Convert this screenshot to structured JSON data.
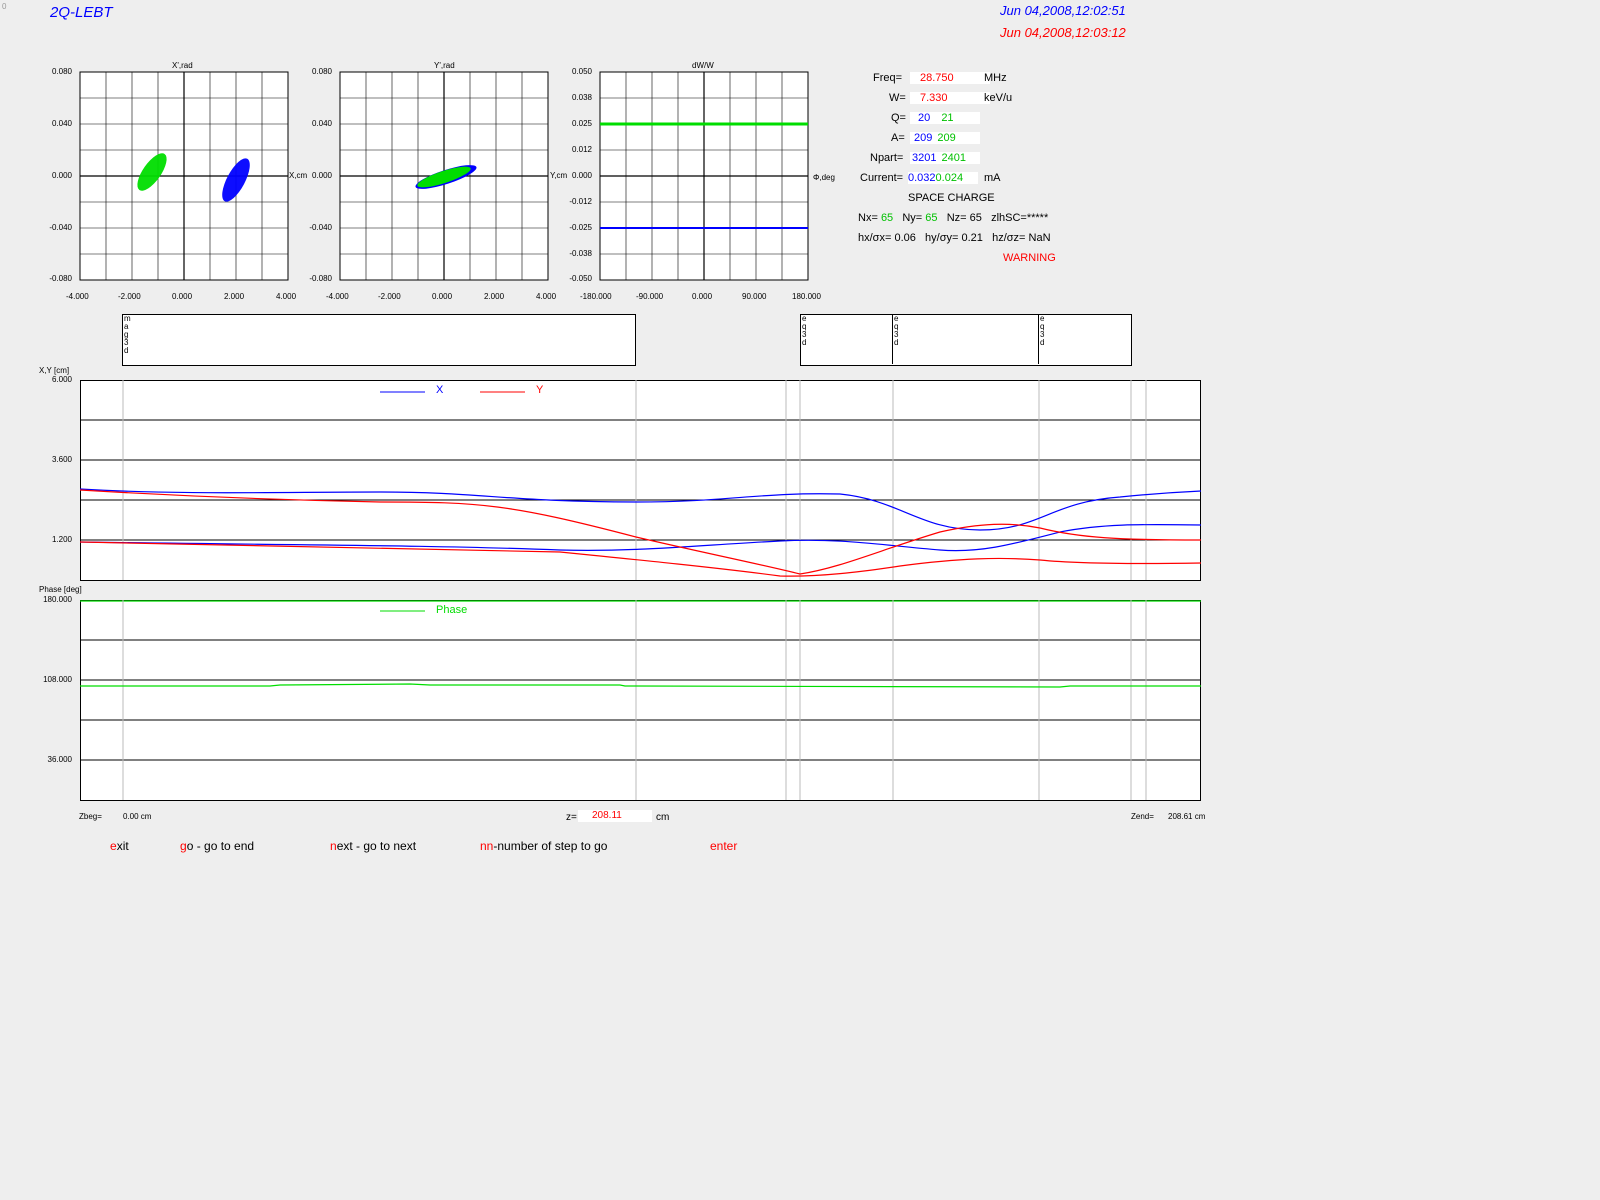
{
  "window": {
    "corner_mark": "0",
    "title": "2Q-LEBT",
    "date_start": "Jun 04,2008,12:02:51",
    "date_end": "Jun 04,2008,12:03:12"
  },
  "phase_plots": {
    "x_plot": {
      "title": "X',rad",
      "side_label": "X,cm",
      "y_ticks": [
        "0.080",
        "0.040",
        "0.000",
        "-0.040",
        "-0.080"
      ],
      "x_ticks": [
        "-4.000",
        "-2.000",
        "0.000",
        "2.000",
        "4.000"
      ]
    },
    "y_plot": {
      "title": "Y',rad",
      "side_label": "Y,cm",
      "y_ticks": [
        "0.080",
        "0.040",
        "0.000",
        "-0.040",
        "-0.080"
      ],
      "x_ticks": [
        "-4.000",
        "-2.000",
        "0.000",
        "2.000",
        "4.000"
      ]
    },
    "w_plot": {
      "title": "dW/W",
      "side_label": "Φ,deg",
      "y_ticks": [
        "0.050",
        "0.038",
        "0.025",
        "0.012",
        "0.000",
        "-0.012",
        "-0.025",
        "-0.038",
        "-0.050"
      ],
      "x_ticks": [
        "-180.000",
        "-90.000",
        "0.000",
        "90.000",
        "180.000"
      ]
    }
  },
  "params": {
    "freq": {
      "label": "Freq=",
      "value": "28.750",
      "unit": "MHz"
    },
    "w": {
      "label": "W=",
      "value": "7.330",
      "unit": "keV/u"
    },
    "q": {
      "label": "Q=",
      "v1": "20",
      "v2": "21"
    },
    "a": {
      "label": "A=",
      "v1": "209",
      "v2": "209"
    },
    "npart": {
      "label": "Npart=",
      "v1": "3201",
      "v2": "2401"
    },
    "current": {
      "label": "Current=",
      "v1": "0.032",
      "v2": "0.024",
      "unit": "mA"
    },
    "space_charge": "SPACE CHARGE",
    "nx_label": "Nx=",
    "nx": "65",
    "ny_label": "Ny=",
    "ny": "65",
    "nz": "Nz= 65",
    "zlhsc": "zlhSC=*****",
    "hx_label": "hx/σx=",
    "hx": "0.06",
    "hy_label": "hy/σy=",
    "hy": "0.21",
    "hz_label": "hz/σz=",
    "hz": "NaN",
    "warning": "WARNING"
  },
  "element_boxes": {
    "mag": "m a g 3 d",
    "eq1": "e q 3 d",
    "eq2": "e q 3 d",
    "eq3": "e q 3 d"
  },
  "envelope_plot": {
    "ylabel": "X,Y [cm]",
    "y_ticks": [
      "6.000",
      "3.600",
      "1.200"
    ],
    "legend_x": "X",
    "legend_y": "Y"
  },
  "phase_plot": {
    "ylabel": "Phase [deg]",
    "y_ticks": [
      "180.000",
      "108.000",
      "36.000"
    ],
    "legend": "Phase"
  },
  "footer": {
    "zbeg_label": "Zbeg=",
    "zbeg": "0.00 cm",
    "z_label": "z=",
    "z": "208.11",
    "z_unit": "cm",
    "zend_label": "Zend=",
    "zend": "208.61 cm"
  },
  "commands": {
    "exit": {
      "hotkey": "e",
      "rest": "xit"
    },
    "go": {
      "hotkey": "g",
      "rest": "o - go to end"
    },
    "next": {
      "hotkey": "n",
      "rest": "ext - go to next"
    },
    "nn": {
      "hotkey": "nn",
      "rest": "-number of step to go"
    },
    "enter": {
      "hotkey": "enter",
      "rest": ""
    }
  },
  "colors": {
    "x": "#0000ff",
    "y": "#ff0000",
    "phase": "#00dd00",
    "beam1": "#00dd00",
    "beam2": "#0000ff"
  }
}
